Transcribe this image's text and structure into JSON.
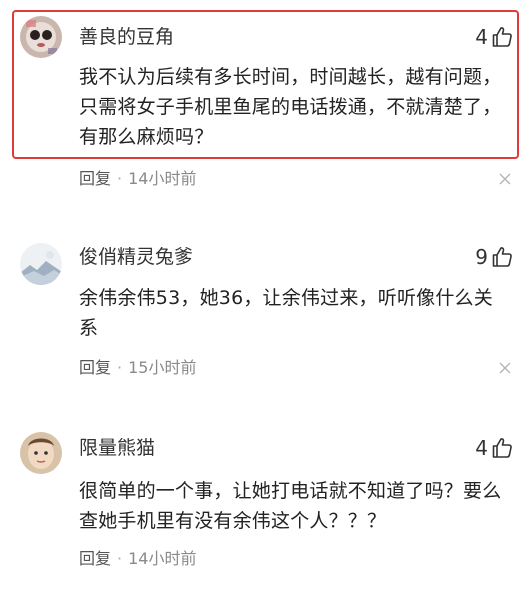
{
  "comments": [
    {
      "username": "善良的豆角",
      "likes": "4",
      "text": "我不认为后续有多长时间，时间越长，越有问题，只需将女子手机里鱼尾的电话拨通，不就清楚了，有那么麻烦吗？",
      "reply_label": "回复",
      "separator": "·",
      "time": "14小时前",
      "avatar_icon": "avatar-cartoon-icon"
    },
    {
      "username": "俊俏精灵兔爹",
      "likes": "9",
      "text": "余伟余伟53，她36，让余伟过来，听听像什么关系",
      "reply_label": "回复",
      "separator": "·",
      "time": "15小时前",
      "avatar_icon": "avatar-landscape-icon"
    },
    {
      "username": "限量熊猫",
      "likes": "4",
      "text": "很简单的一个事，让她打电话就不知道了吗？要么查她手机里有没有余伟这个人？？？",
      "reply_label": "回复",
      "separator": "·",
      "time": "14小时前",
      "avatar_icon": "avatar-face-icon"
    }
  ],
  "colors": {
    "highlight_border": "#e03a3a",
    "meta_text": "#8a8a8a",
    "body_text": "#222222"
  }
}
